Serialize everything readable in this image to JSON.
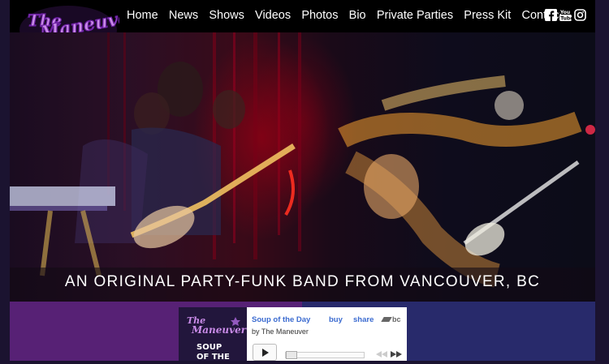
{
  "brand": {
    "logo_text_top": "The",
    "logo_text_main": "Maneuver"
  },
  "nav": {
    "items": [
      {
        "label": "Home"
      },
      {
        "label": "News"
      },
      {
        "label": "Shows"
      },
      {
        "label": "Videos"
      },
      {
        "label": "Photos"
      },
      {
        "label": "Bio"
      },
      {
        "label": "Private Parties"
      },
      {
        "label": "Press Kit"
      },
      {
        "label": "Contact"
      }
    ]
  },
  "social": [
    {
      "icon": "facebook-icon"
    },
    {
      "icon": "youtube-icon"
    },
    {
      "icon": "instagram-icon"
    }
  ],
  "hero": {
    "tagline": "AN ORIGINAL PARTY-FUNK BAND FROM VANCOUVER, BC"
  },
  "player": {
    "track_title": "Soup of the Day",
    "artist": "by The Maneuver",
    "buy_label": "buy",
    "share_label": "share",
    "service_label": "bc",
    "album_text_top": "SOUP",
    "album_text_bottom": "OF THE"
  },
  "colors": {
    "logo_purple": "#8a3fc8",
    "band_purple": "#572175",
    "band_indigo": "#282a6b",
    "link_blue": "#3b6bd0"
  }
}
